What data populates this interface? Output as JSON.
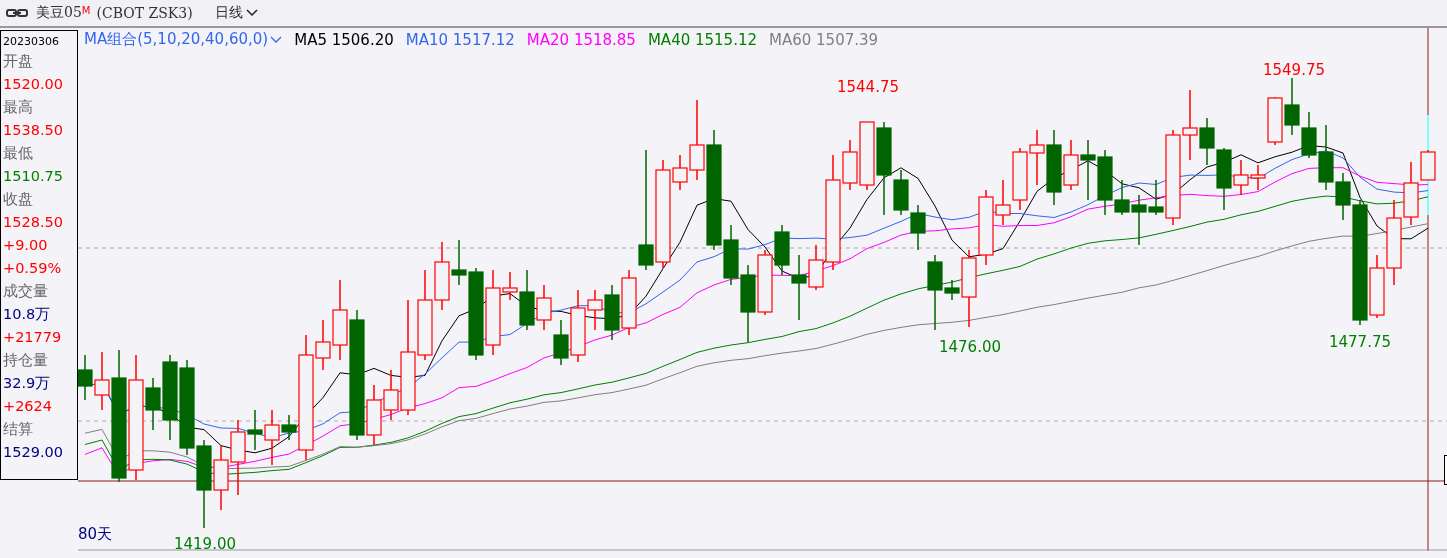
{
  "toolbar": {
    "symbol": "美豆05",
    "badge": "M",
    "contract": "(CBOT  ZSK3)",
    "period": "日线"
  },
  "info_panel": {
    "date": "20230306",
    "rows": [
      {
        "kind": "label",
        "text": "开盘"
      },
      {
        "kind": "value",
        "text": "1520.00",
        "color": "#ff0000"
      },
      {
        "kind": "label",
        "text": "最高"
      },
      {
        "kind": "value",
        "text": "1538.50",
        "color": "#ff0000"
      },
      {
        "kind": "label",
        "text": "最低"
      },
      {
        "kind": "value",
        "text": "1510.75",
        "color": "#008000"
      },
      {
        "kind": "label",
        "text": "收盘"
      },
      {
        "kind": "value",
        "text": "1528.50",
        "color": "#ff0000"
      },
      {
        "kind": "value",
        "text": "+9.00",
        "color": "#ff0000"
      },
      {
        "kind": "value",
        "text": "+0.59%",
        "color": "#ff0000"
      },
      {
        "kind": "label",
        "text": "成交量"
      },
      {
        "kind": "value",
        "text": "10.8万",
        "color": "#000080"
      },
      {
        "kind": "value",
        "text": "+21779",
        "color": "#ff0000"
      },
      {
        "kind": "label",
        "text": "持仓量"
      },
      {
        "kind": "value",
        "text": "32.9万",
        "color": "#000080"
      },
      {
        "kind": "value",
        "text": "+2624",
        "color": "#ff0000"
      },
      {
        "kind": "label",
        "text": "结算"
      },
      {
        "kind": "value",
        "text": "1529.00",
        "color": "#000080"
      }
    ]
  },
  "ma_legend": {
    "group": "MA组合(5,10,20,40,60,0)",
    "items": [
      {
        "label": "MA5 1506.20",
        "color": "#000000"
      },
      {
        "label": "MA10 1517.12",
        "color": "#3366ee"
      },
      {
        "label": "MA20 1518.85",
        "color": "#ff00ff"
      },
      {
        "label": "MA40 1515.12",
        "color": "#008000"
      },
      {
        "label": "MA60 1507.39",
        "color": "#808080"
      }
    ]
  },
  "price_marks": [
    {
      "kind": "high",
      "text": "1544.75"
    },
    {
      "kind": "high",
      "text": "1549.75"
    },
    {
      "kind": "low",
      "text": "1476.00"
    },
    {
      "kind": "low",
      "text": "1477.75"
    },
    {
      "kind": "low",
      "text": "1419.00"
    }
  ],
  "range_label": "80天"
}
